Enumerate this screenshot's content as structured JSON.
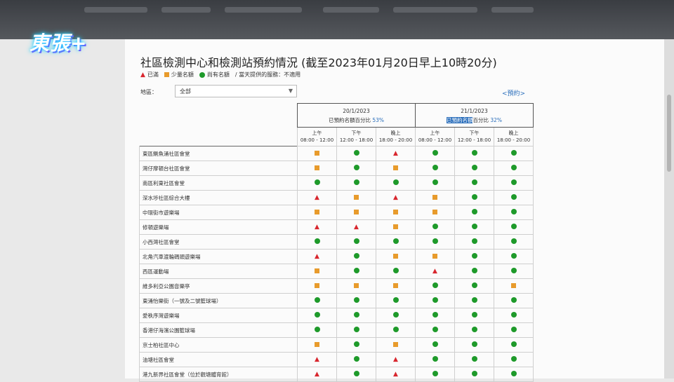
{
  "title": "社區檢測中心和檢測站預約情況 (截至2023年01月20日早上10時20分)",
  "legend": {
    "full": "已滿",
    "few": "少量名額",
    "available": "尚有名額",
    "na": "/ 當天提供的服務：不適用"
  },
  "region": {
    "label": "地區：",
    "selected": "全部"
  },
  "back_link": "<預約>",
  "dates": [
    {
      "date": "20/1/2023",
      "booked_label": "已預約名額百分比",
      "pct": "53%"
    },
    {
      "date": "21/1/2023",
      "booked_label_hl": "已預約名額",
      "booked_label_rest": "百分比",
      "pct": "32%"
    }
  ],
  "slots": [
    {
      "period": "上午",
      "time": "08:00 - 12:00"
    },
    {
      "period": "下午",
      "time": "12:00 - 18:00"
    },
    {
      "period": "晚上",
      "time": "18:00 - 20:00"
    },
    {
      "period": "上午",
      "time": "08:00 - 12:00"
    },
    {
      "period": "下午",
      "time": "12:00 - 18:00"
    },
    {
      "period": "晚上",
      "time": "18:00 - 20:00"
    }
  ],
  "colors": {
    "full": "#d8262e",
    "few": "#e89b2c",
    "available": "#1e9a2a"
  },
  "rows": [
    {
      "name": "東區鰂魚涌社區會堂",
      "s": [
        "few",
        "available",
        "full",
        "available",
        "available",
        "available"
      ],
      "group": true
    },
    {
      "name": "灣仔摩頓台社區會堂",
      "s": [
        "few",
        "available",
        "few",
        "available",
        "available",
        "available"
      ]
    },
    {
      "name": "南區利東社區會堂",
      "s": [
        "available",
        "available",
        "available",
        "available",
        "available",
        "available"
      ]
    },
    {
      "name": "深水埗社區綜合大樓",
      "s": [
        "full",
        "few",
        "full",
        "few",
        "available",
        "available"
      ],
      "group": true
    },
    {
      "name": "中環街市遊樂場",
      "s": [
        "few",
        "few",
        "few",
        "few",
        "available",
        "available"
      ]
    },
    {
      "name": "修頓遊樂場",
      "s": [
        "full",
        "full",
        "few",
        "available",
        "available",
        "available"
      ]
    },
    {
      "name": "小西灣社區會堂",
      "s": [
        "available",
        "available",
        "available",
        "available",
        "available",
        "available"
      ],
      "group": true
    },
    {
      "name": "北角汽車渡輪碼頭遊樂場",
      "s": [
        "full",
        "available",
        "few",
        "few",
        "available",
        "available"
      ]
    },
    {
      "name": "西區運動場",
      "s": [
        "few",
        "available",
        "available",
        "full",
        "available",
        "available"
      ]
    },
    {
      "name": "維多利亞公園音樂亭",
      "s": [
        "few",
        "few",
        "few",
        "available",
        "available",
        "few"
      ]
    },
    {
      "name": "東涌怡樂街（一號及二號籃球場）",
      "s": [
        "available",
        "available",
        "available",
        "available",
        "available",
        "available"
      ],
      "group": true
    },
    {
      "name": "愛秩序灣遊樂場",
      "s": [
        "available",
        "available",
        "available",
        "available",
        "available",
        "available"
      ]
    },
    {
      "name": "香港仔海濱公園籃球場",
      "s": [
        "available",
        "available",
        "available",
        "available",
        "available",
        "available"
      ]
    },
    {
      "name": "京士柏社區中心",
      "s": [
        "few",
        "available",
        "few",
        "available",
        "available",
        "available"
      ],
      "group": true
    },
    {
      "name": "油塘社區會堂",
      "s": [
        "full",
        "available",
        "full",
        "available",
        "available",
        "available"
      ]
    },
    {
      "name": "港九新界社區會堂（位於觀塘體育館）",
      "s": [
        "full",
        "available",
        "full",
        "available",
        "available",
        "available"
      ]
    }
  ]
}
